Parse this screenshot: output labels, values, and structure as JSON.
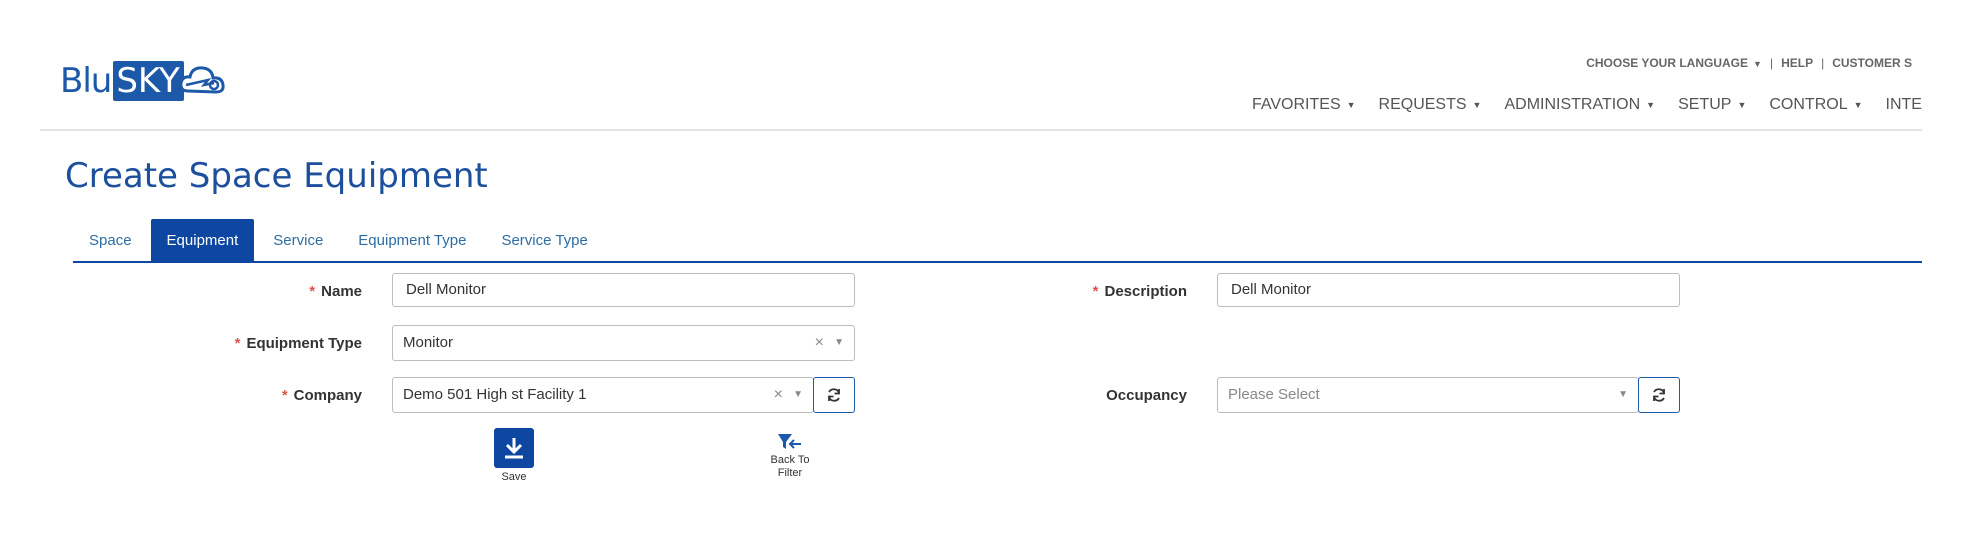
{
  "logo": {
    "part1": "Blu",
    "part2": "SKY"
  },
  "top_links": {
    "language": "CHOOSE YOUR LANGUAGE",
    "sep1": "|",
    "help": "HELP",
    "sep2": "|",
    "customer_support": "CUSTOMER S"
  },
  "nav": [
    {
      "label": "FAVORITES"
    },
    {
      "label": "REQUESTS"
    },
    {
      "label": "ADMINISTRATION"
    },
    {
      "label": "SETUP"
    },
    {
      "label": "CONTROL"
    },
    {
      "label": "INTE"
    }
  ],
  "page": {
    "title": "Create Space Equipment"
  },
  "tabs": [
    {
      "label": "Space"
    },
    {
      "label": "Equipment"
    },
    {
      "label": "Service"
    },
    {
      "label": "Equipment Type"
    },
    {
      "label": "Service Type"
    }
  ],
  "form": {
    "required_mark": "*",
    "name": {
      "label": "Name",
      "value": "Dell Monitor"
    },
    "description": {
      "label": "Description",
      "value": "Dell Monitor"
    },
    "equipment_type": {
      "label": "Equipment Type",
      "value": "Monitor"
    },
    "company": {
      "label": "Company",
      "value": "Demo 501 High st Facility 1"
    },
    "occupancy": {
      "label": "Occupancy",
      "placeholder": "Please Select"
    },
    "clear_glyph": "×"
  },
  "actions": {
    "save": "Save",
    "back_to_filter_line1": "Back To",
    "back_to_filter_line2": "Filter"
  },
  "colors": {
    "brand": "#1c59a8",
    "tab_active": "#0d47a1",
    "title": "#1c4f9c",
    "required": "#d9534f"
  }
}
